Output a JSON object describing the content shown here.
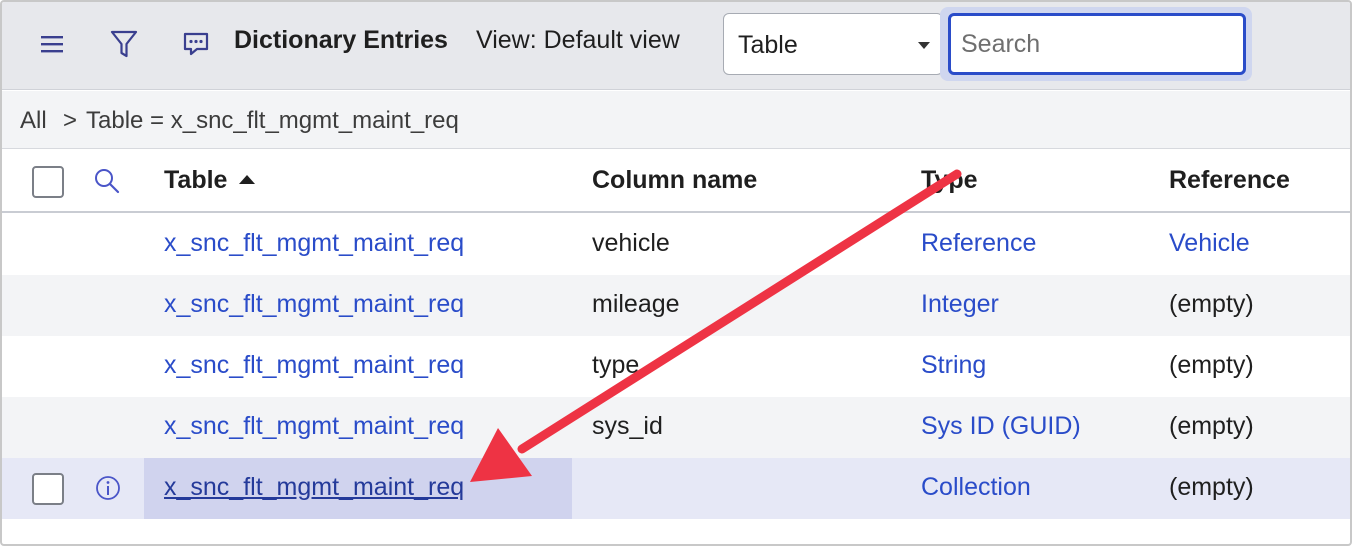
{
  "header": {
    "title": "Dictionary Entries",
    "view_label": "View: Default view",
    "icons": [
      "menu-icon",
      "filter-icon",
      "comment-icon"
    ],
    "select": {
      "value": "Table"
    },
    "search": {
      "placeholder": "Search",
      "value": ""
    }
  },
  "breadcrumb": {
    "items": [
      "All",
      ">",
      "Table = x_snc_flt_mgmt_maint_req"
    ]
  },
  "columns": [
    "Table",
    "Column name",
    "Type",
    "Reference"
  ],
  "sort": {
    "column": "Table",
    "direction": "ascending"
  },
  "rows": [
    {
      "table": "x_snc_flt_mgmt_maint_req",
      "column_name": "vehicle",
      "type": "Reference",
      "reference": "Vehicle"
    },
    {
      "table": "x_snc_flt_mgmt_maint_req",
      "column_name": "mileage",
      "type": "Integer",
      "reference": "(empty)"
    },
    {
      "table": "x_snc_flt_mgmt_maint_req",
      "column_name": "type",
      "type": "String",
      "reference": "(empty)"
    },
    {
      "table": "x_snc_flt_mgmt_maint_req",
      "column_name": "sys_id",
      "type": "Sys ID (GUID)",
      "reference": "(empty)"
    },
    {
      "table": "x_snc_flt_mgmt_maint_req",
      "column_name": "",
      "type": "Collection",
      "reference": "(empty)"
    }
  ],
  "colors": {
    "link": "#2a4cc9",
    "annotation_arrow": "#ee3344",
    "selected_row": "#e6e8f6",
    "highlight_cell": "#d0d3ee"
  }
}
